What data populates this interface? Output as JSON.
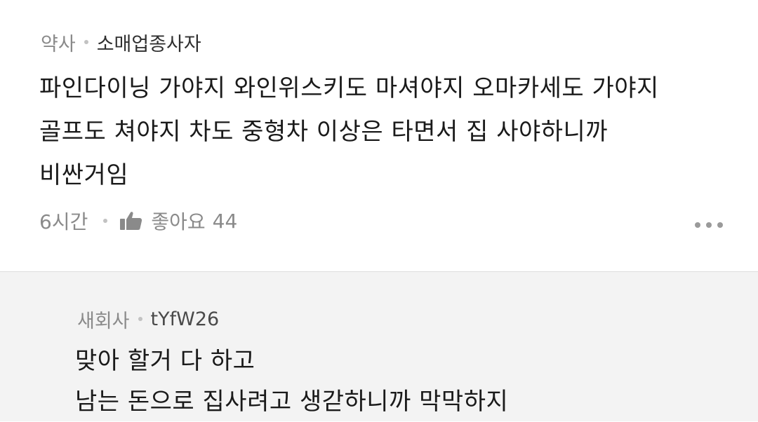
{
  "comment": {
    "author_type": "약사",
    "author_name": "소매업종사자",
    "body_lines": [
      "파인다이닝 가야지 와인위스키도 마셔야지 오마카세도 가야지",
      "골프도 쳐야지 차도 중형차 이상은 타면서 집 사야하니까",
      "비싼거임"
    ],
    "time": "6시간",
    "like_label": "좋아요",
    "like_count": "44",
    "icons": {
      "like": "thumbs-up-icon",
      "more": "more-dots-icon"
    }
  },
  "reply": {
    "author_type": "새회사",
    "author_name": "tYfW26",
    "body_lines": [
      "맞아 할거 다 하고",
      "남는 돈으로 집사려고 생갇하니까 막막하지"
    ]
  },
  "colors": {
    "reply_background": "#f3f3f3",
    "meta_text": "#8a8a8a",
    "body_text": "#1a1a1a"
  }
}
